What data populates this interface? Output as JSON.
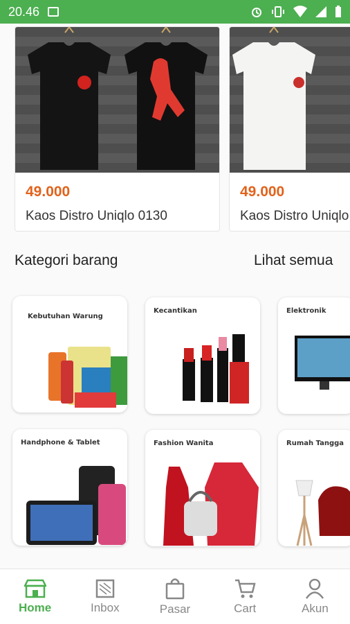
{
  "status_bar": {
    "time": "20.46"
  },
  "products": [
    {
      "price": "49.000",
      "name": "Kaos Distro Uniqlo 0130"
    },
    {
      "price": "49.000",
      "name": "Kaos Distro Uniqlo"
    }
  ],
  "categories_section": {
    "title": "Kategori barang",
    "see_all": "Lihat semua"
  },
  "categories": [
    {
      "label": "Kebutuhan Warung"
    },
    {
      "label": "Kecantikan"
    },
    {
      "label": "Elektronik"
    },
    {
      "label": "Handphone & Tablet"
    },
    {
      "label": "Fashion Wanita"
    },
    {
      "label": "Rumah Tangga"
    }
  ],
  "bottom_nav": {
    "items": [
      {
        "label": "Home",
        "icon": "store-icon",
        "active": true
      },
      {
        "label": "Inbox",
        "icon": "inbox-icon",
        "active": false
      },
      {
        "label": "Pasar",
        "icon": "shopping-bag-icon",
        "active": false
      },
      {
        "label": "Cart",
        "icon": "cart-icon",
        "active": false
      },
      {
        "label": "Akun",
        "icon": "user-icon",
        "active": false
      }
    ]
  },
  "colors": {
    "primary": "#4caf50",
    "price": "#e2621b"
  }
}
